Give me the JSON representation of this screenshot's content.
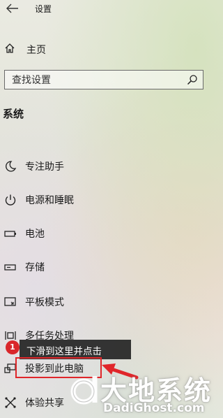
{
  "window": {
    "title": "设置"
  },
  "nav": {
    "home_label": "主页"
  },
  "search": {
    "placeholder": "查找设置"
  },
  "section": {
    "title": "系统"
  },
  "menu": {
    "items": [
      {
        "label": "专注助手",
        "icon": "moon-icon"
      },
      {
        "label": "电源和睡眠",
        "icon": "power-icon"
      },
      {
        "label": "电池",
        "icon": "battery-icon"
      },
      {
        "label": "存储",
        "icon": "storage-icon"
      },
      {
        "label": "平板模式",
        "icon": "tablet-mode-icon"
      },
      {
        "label": "多任务处理",
        "icon": "multitasking-icon"
      },
      {
        "label": "投影到此电脑",
        "icon": "project-icon"
      },
      {
        "label": "体验共享",
        "icon": "shared-experiences-icon"
      }
    ]
  },
  "annotation": {
    "step_number": "1",
    "tooltip_text": "下滑到这里并点击",
    "highlight_color": "#e0262a",
    "tooltip_background": "#262626"
  },
  "watermark": {
    "title": "大地系统",
    "url": "DadiGhost.com"
  }
}
